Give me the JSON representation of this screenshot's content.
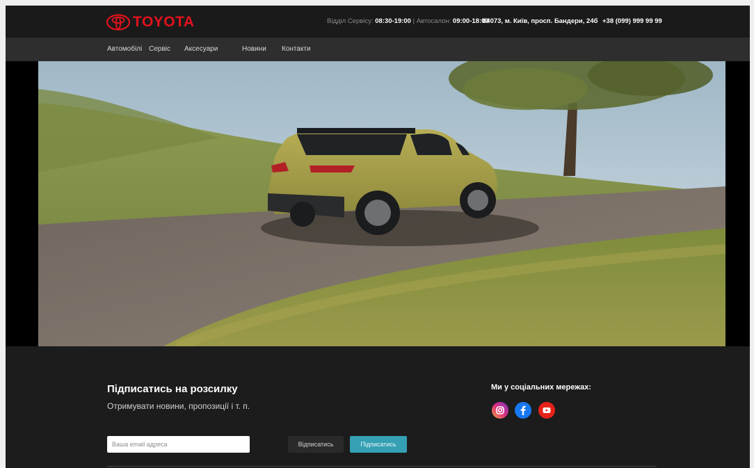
{
  "brand": {
    "name": "TOYOTA",
    "color": "#e1121c"
  },
  "topbar": {
    "service_label": "Відділ Сервісу:",
    "service_hours": "08:30-19:00",
    "separator": "|",
    "showroom_label": "Автосалон:",
    "showroom_hours": "09:00-18:00",
    "address": "04073, м. Київ, просп. Бандери, 24б",
    "phone": "+38 (099) 999 99 99"
  },
  "nav": {
    "items": [
      {
        "label": "Автомобілі"
      },
      {
        "label": "Сервіс"
      },
      {
        "label": "Аксесуари"
      },
      {
        "label": "Новини"
      },
      {
        "label": "Контакти"
      }
    ]
  },
  "newsletter": {
    "title": "Підписатись на розсилку",
    "subtitle": "Отримувати новини, пропозиції і т. п.",
    "email_placeholder": "Ваша email адреса",
    "unsubscribe_label": "Відписатись",
    "subscribe_label": "Підписатись"
  },
  "social": {
    "title": "Ми у соціальних мережах:",
    "icons": [
      "instagram-icon",
      "facebook-icon",
      "youtube-icon"
    ]
  },
  "colors": {
    "accent_teal": "#35a0b3",
    "background": "#1c1c1d"
  }
}
